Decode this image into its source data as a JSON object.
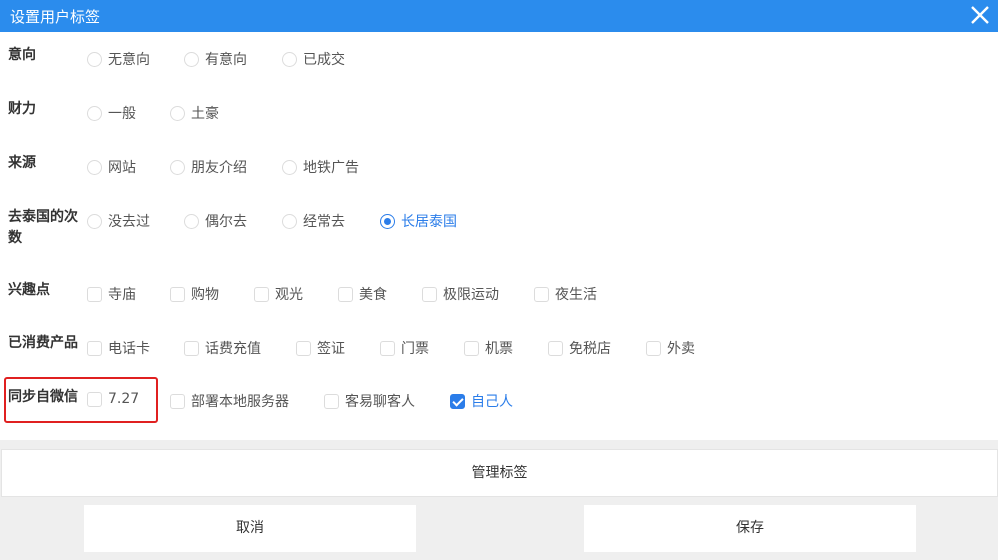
{
  "dialog": {
    "title": "设置用户标签",
    "close_icon": "close-icon"
  },
  "groups": [
    {
      "label": "意向",
      "type": "radio",
      "options": [
        {
          "label": "无意向",
          "checked": false
        },
        {
          "label": "有意向",
          "checked": false
        },
        {
          "label": "已成交",
          "checked": false
        }
      ]
    },
    {
      "label": "财力",
      "type": "radio",
      "options": [
        {
          "label": "一般",
          "checked": false
        },
        {
          "label": "土豪",
          "checked": false
        }
      ]
    },
    {
      "label": "来源",
      "type": "radio",
      "options": [
        {
          "label": "网站",
          "checked": false
        },
        {
          "label": "朋友介绍",
          "checked": false
        },
        {
          "label": "地铁广告",
          "checked": false
        }
      ]
    },
    {
      "label": "去泰国的次数",
      "type": "radio",
      "options": [
        {
          "label": "没去过",
          "checked": false
        },
        {
          "label": "偶尔去",
          "checked": false
        },
        {
          "label": "经常去",
          "checked": false
        },
        {
          "label": "长居泰国",
          "checked": true
        }
      ]
    },
    {
      "label": "兴趣点",
      "type": "check",
      "options": [
        {
          "label": "寺庙",
          "checked": false
        },
        {
          "label": "购物",
          "checked": false
        },
        {
          "label": "观光",
          "checked": false
        },
        {
          "label": "美食",
          "checked": false
        },
        {
          "label": "极限运动",
          "checked": false
        },
        {
          "label": "夜生活",
          "checked": false
        }
      ]
    },
    {
      "label": "已消费产品",
      "type": "check",
      "options": [
        {
          "label": "电话卡",
          "checked": false
        },
        {
          "label": "话费充值",
          "checked": false
        },
        {
          "label": "签证",
          "checked": false
        },
        {
          "label": "门票",
          "checked": false
        },
        {
          "label": "机票",
          "checked": false
        },
        {
          "label": "免税店",
          "checked": false
        },
        {
          "label": "外卖",
          "checked": false
        }
      ]
    },
    {
      "label": "同步自微信",
      "type": "check",
      "options": [
        {
          "label": "7.27",
          "checked": false
        },
        {
          "label": "部署本地服务器",
          "checked": false
        },
        {
          "label": "客易聊客人",
          "checked": false
        },
        {
          "label": "自己人",
          "checked": true
        }
      ]
    }
  ],
  "footer": {
    "manage_label": "管理标签",
    "cancel_label": "取消",
    "save_label": "保存"
  }
}
